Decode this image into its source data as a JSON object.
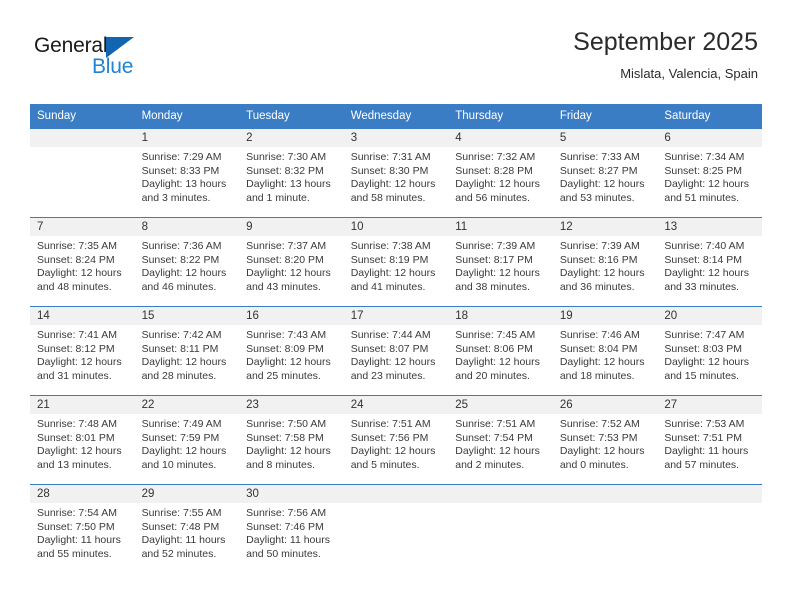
{
  "brand": {
    "name_part1": "General",
    "name_part2": "Blue",
    "logo_icon": "triangle-logo-icon",
    "accent_color": "#2083d4",
    "logo_color": "#1265b0"
  },
  "header": {
    "title": "September 2025",
    "subtitle": "Mislata, Valencia, Spain"
  },
  "calendar": {
    "header_bg": "#3b7dc4",
    "daynum_bg": "#f1f1f1",
    "weekday_headers": [
      "Sunday",
      "Monday",
      "Tuesday",
      "Wednesday",
      "Thursday",
      "Friday",
      "Saturday"
    ],
    "labels": {
      "sunrise": "Sunrise:",
      "sunset": "Sunset:",
      "daylight": "Daylight:"
    },
    "weeks": [
      [
        {
          "day": "",
          "empty": true,
          "sunrise": "",
          "sunset": "",
          "daylight_line1": "",
          "daylight_line2": ""
        },
        {
          "day": "1",
          "empty": false,
          "sunrise": "Sunrise: 7:29 AM",
          "sunset": "Sunset: 8:33 PM",
          "daylight_line1": "Daylight: 13 hours",
          "daylight_line2": "and 3 minutes."
        },
        {
          "day": "2",
          "empty": false,
          "sunrise": "Sunrise: 7:30 AM",
          "sunset": "Sunset: 8:32 PM",
          "daylight_line1": "Daylight: 13 hours",
          "daylight_line2": "and 1 minute."
        },
        {
          "day": "3",
          "empty": false,
          "sunrise": "Sunrise: 7:31 AM",
          "sunset": "Sunset: 8:30 PM",
          "daylight_line1": "Daylight: 12 hours",
          "daylight_line2": "and 58 minutes."
        },
        {
          "day": "4",
          "empty": false,
          "sunrise": "Sunrise: 7:32 AM",
          "sunset": "Sunset: 8:28 PM",
          "daylight_line1": "Daylight: 12 hours",
          "daylight_line2": "and 56 minutes."
        },
        {
          "day": "5",
          "empty": false,
          "sunrise": "Sunrise: 7:33 AM",
          "sunset": "Sunset: 8:27 PM",
          "daylight_line1": "Daylight: 12 hours",
          "daylight_line2": "and 53 minutes."
        },
        {
          "day": "6",
          "empty": false,
          "sunrise": "Sunrise: 7:34 AM",
          "sunset": "Sunset: 8:25 PM",
          "daylight_line1": "Daylight: 12 hours",
          "daylight_line2": "and 51 minutes."
        }
      ],
      [
        {
          "day": "7",
          "empty": false,
          "sunrise": "Sunrise: 7:35 AM",
          "sunset": "Sunset: 8:24 PM",
          "daylight_line1": "Daylight: 12 hours",
          "daylight_line2": "and 48 minutes."
        },
        {
          "day": "8",
          "empty": false,
          "sunrise": "Sunrise: 7:36 AM",
          "sunset": "Sunset: 8:22 PM",
          "daylight_line1": "Daylight: 12 hours",
          "daylight_line2": "and 46 minutes."
        },
        {
          "day": "9",
          "empty": false,
          "sunrise": "Sunrise: 7:37 AM",
          "sunset": "Sunset: 8:20 PM",
          "daylight_line1": "Daylight: 12 hours",
          "daylight_line2": "and 43 minutes."
        },
        {
          "day": "10",
          "empty": false,
          "sunrise": "Sunrise: 7:38 AM",
          "sunset": "Sunset: 8:19 PM",
          "daylight_line1": "Daylight: 12 hours",
          "daylight_line2": "and 41 minutes."
        },
        {
          "day": "11",
          "empty": false,
          "sunrise": "Sunrise: 7:39 AM",
          "sunset": "Sunset: 8:17 PM",
          "daylight_line1": "Daylight: 12 hours",
          "daylight_line2": "and 38 minutes."
        },
        {
          "day": "12",
          "empty": false,
          "sunrise": "Sunrise: 7:39 AM",
          "sunset": "Sunset: 8:16 PM",
          "daylight_line1": "Daylight: 12 hours",
          "daylight_line2": "and 36 minutes."
        },
        {
          "day": "13",
          "empty": false,
          "sunrise": "Sunrise: 7:40 AM",
          "sunset": "Sunset: 8:14 PM",
          "daylight_line1": "Daylight: 12 hours",
          "daylight_line2": "and 33 minutes."
        }
      ],
      [
        {
          "day": "14",
          "empty": false,
          "sunrise": "Sunrise: 7:41 AM",
          "sunset": "Sunset: 8:12 PM",
          "daylight_line1": "Daylight: 12 hours",
          "daylight_line2": "and 31 minutes."
        },
        {
          "day": "15",
          "empty": false,
          "sunrise": "Sunrise: 7:42 AM",
          "sunset": "Sunset: 8:11 PM",
          "daylight_line1": "Daylight: 12 hours",
          "daylight_line2": "and 28 minutes."
        },
        {
          "day": "16",
          "empty": false,
          "sunrise": "Sunrise: 7:43 AM",
          "sunset": "Sunset: 8:09 PM",
          "daylight_line1": "Daylight: 12 hours",
          "daylight_line2": "and 25 minutes."
        },
        {
          "day": "17",
          "empty": false,
          "sunrise": "Sunrise: 7:44 AM",
          "sunset": "Sunset: 8:07 PM",
          "daylight_line1": "Daylight: 12 hours",
          "daylight_line2": "and 23 minutes."
        },
        {
          "day": "18",
          "empty": false,
          "sunrise": "Sunrise: 7:45 AM",
          "sunset": "Sunset: 8:06 PM",
          "daylight_line1": "Daylight: 12 hours",
          "daylight_line2": "and 20 minutes."
        },
        {
          "day": "19",
          "empty": false,
          "sunrise": "Sunrise: 7:46 AM",
          "sunset": "Sunset: 8:04 PM",
          "daylight_line1": "Daylight: 12 hours",
          "daylight_line2": "and 18 minutes."
        },
        {
          "day": "20",
          "empty": false,
          "sunrise": "Sunrise: 7:47 AM",
          "sunset": "Sunset: 8:03 PM",
          "daylight_line1": "Daylight: 12 hours",
          "daylight_line2": "and 15 minutes."
        }
      ],
      [
        {
          "day": "21",
          "empty": false,
          "sunrise": "Sunrise: 7:48 AM",
          "sunset": "Sunset: 8:01 PM",
          "daylight_line1": "Daylight: 12 hours",
          "daylight_line2": "and 13 minutes."
        },
        {
          "day": "22",
          "empty": false,
          "sunrise": "Sunrise: 7:49 AM",
          "sunset": "Sunset: 7:59 PM",
          "daylight_line1": "Daylight: 12 hours",
          "daylight_line2": "and 10 minutes."
        },
        {
          "day": "23",
          "empty": false,
          "sunrise": "Sunrise: 7:50 AM",
          "sunset": "Sunset: 7:58 PM",
          "daylight_line1": "Daylight: 12 hours",
          "daylight_line2": "and 8 minutes."
        },
        {
          "day": "24",
          "empty": false,
          "sunrise": "Sunrise: 7:51 AM",
          "sunset": "Sunset: 7:56 PM",
          "daylight_line1": "Daylight: 12 hours",
          "daylight_line2": "and 5 minutes."
        },
        {
          "day": "25",
          "empty": false,
          "sunrise": "Sunrise: 7:51 AM",
          "sunset": "Sunset: 7:54 PM",
          "daylight_line1": "Daylight: 12 hours",
          "daylight_line2": "and 2 minutes."
        },
        {
          "day": "26",
          "empty": false,
          "sunrise": "Sunrise: 7:52 AM",
          "sunset": "Sunset: 7:53 PM",
          "daylight_line1": "Daylight: 12 hours",
          "daylight_line2": "and 0 minutes."
        },
        {
          "day": "27",
          "empty": false,
          "sunrise": "Sunrise: 7:53 AM",
          "sunset": "Sunset: 7:51 PM",
          "daylight_line1": "Daylight: 11 hours",
          "daylight_line2": "and 57 minutes."
        }
      ],
      [
        {
          "day": "28",
          "empty": false,
          "sunrise": "Sunrise: 7:54 AM",
          "sunset": "Sunset: 7:50 PM",
          "daylight_line1": "Daylight: 11 hours",
          "daylight_line2": "and 55 minutes."
        },
        {
          "day": "29",
          "empty": false,
          "sunrise": "Sunrise: 7:55 AM",
          "sunset": "Sunset: 7:48 PM",
          "daylight_line1": "Daylight: 11 hours",
          "daylight_line2": "and 52 minutes."
        },
        {
          "day": "30",
          "empty": false,
          "sunrise": "Sunrise: 7:56 AM",
          "sunset": "Sunset: 7:46 PM",
          "daylight_line1": "Daylight: 11 hours",
          "daylight_line2": "and 50 minutes."
        },
        {
          "day": "",
          "empty": true,
          "sunrise": "",
          "sunset": "",
          "daylight_line1": "",
          "daylight_line2": ""
        },
        {
          "day": "",
          "empty": true,
          "sunrise": "",
          "sunset": "",
          "daylight_line1": "",
          "daylight_line2": ""
        },
        {
          "day": "",
          "empty": true,
          "sunrise": "",
          "sunset": "",
          "daylight_line1": "",
          "daylight_line2": ""
        },
        {
          "day": "",
          "empty": true,
          "sunrise": "",
          "sunset": "",
          "daylight_line1": "",
          "daylight_line2": ""
        }
      ]
    ]
  }
}
